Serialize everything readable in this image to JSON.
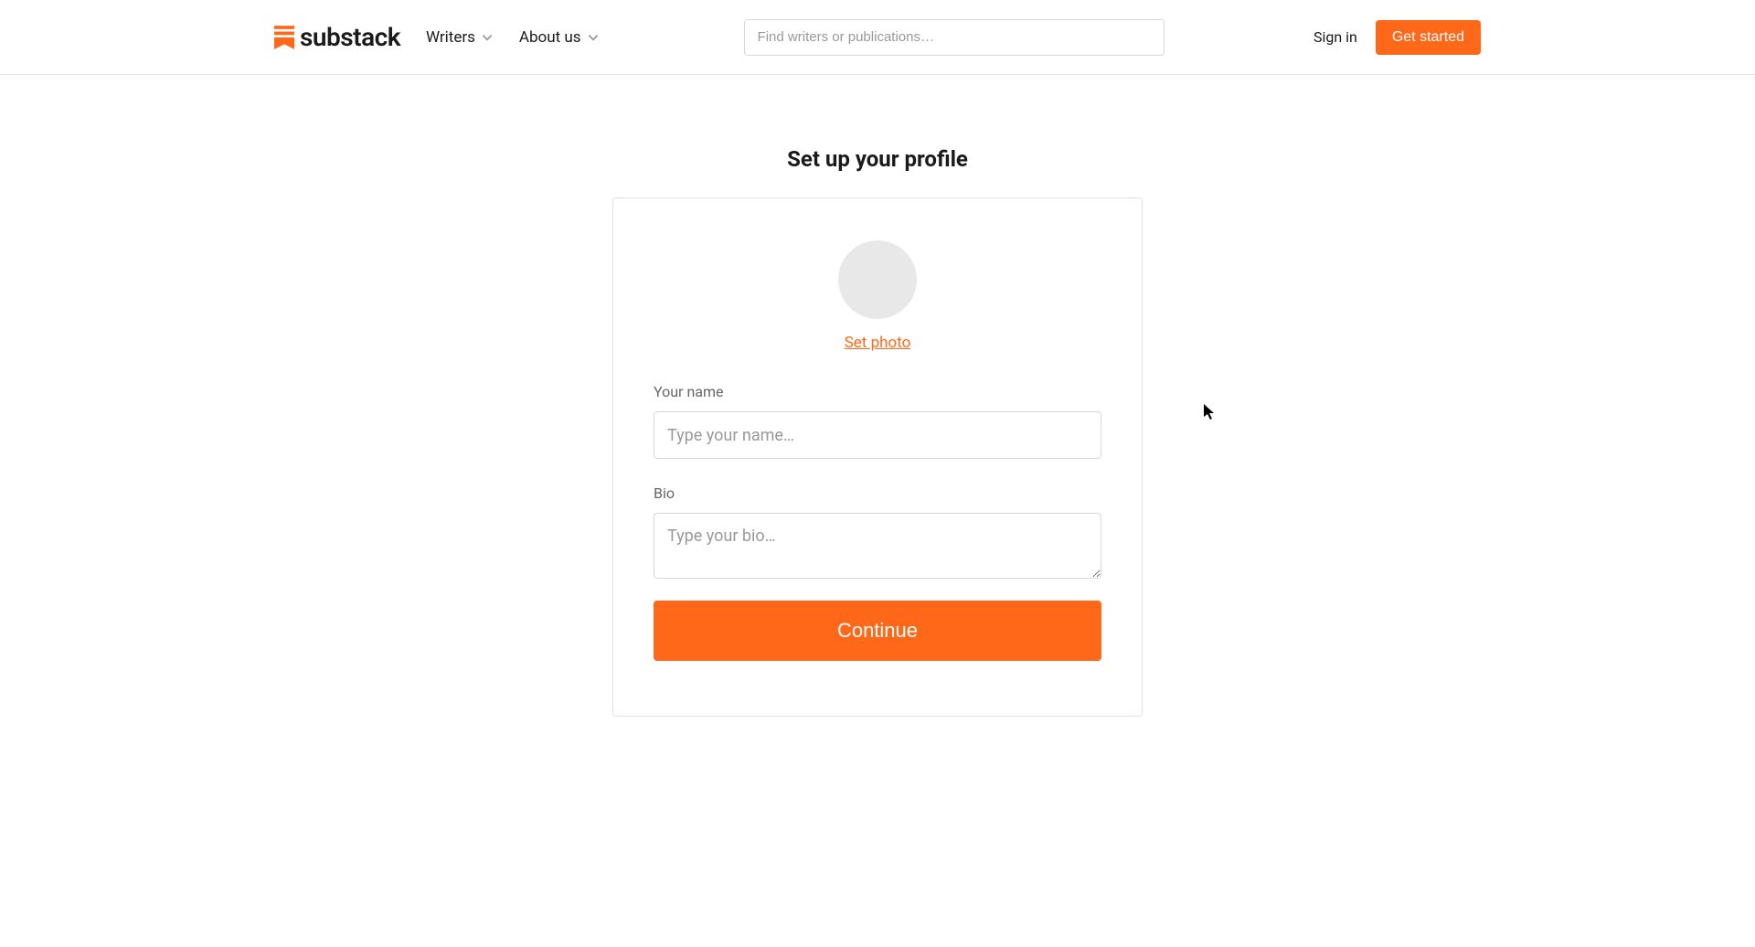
{
  "header": {
    "logo_text": "substack",
    "nav": {
      "writers": "Writers",
      "about_us": "About us"
    },
    "search_placeholder": "Find writers or publications…",
    "sign_in": "Sign in",
    "get_started": "Get started"
  },
  "main": {
    "title": "Set up your profile",
    "set_photo": "Set photo",
    "name_label": "Your name",
    "name_placeholder": "Type your name…",
    "bio_label": "Bio",
    "bio_placeholder": "Type your bio…",
    "continue": "Continue"
  }
}
